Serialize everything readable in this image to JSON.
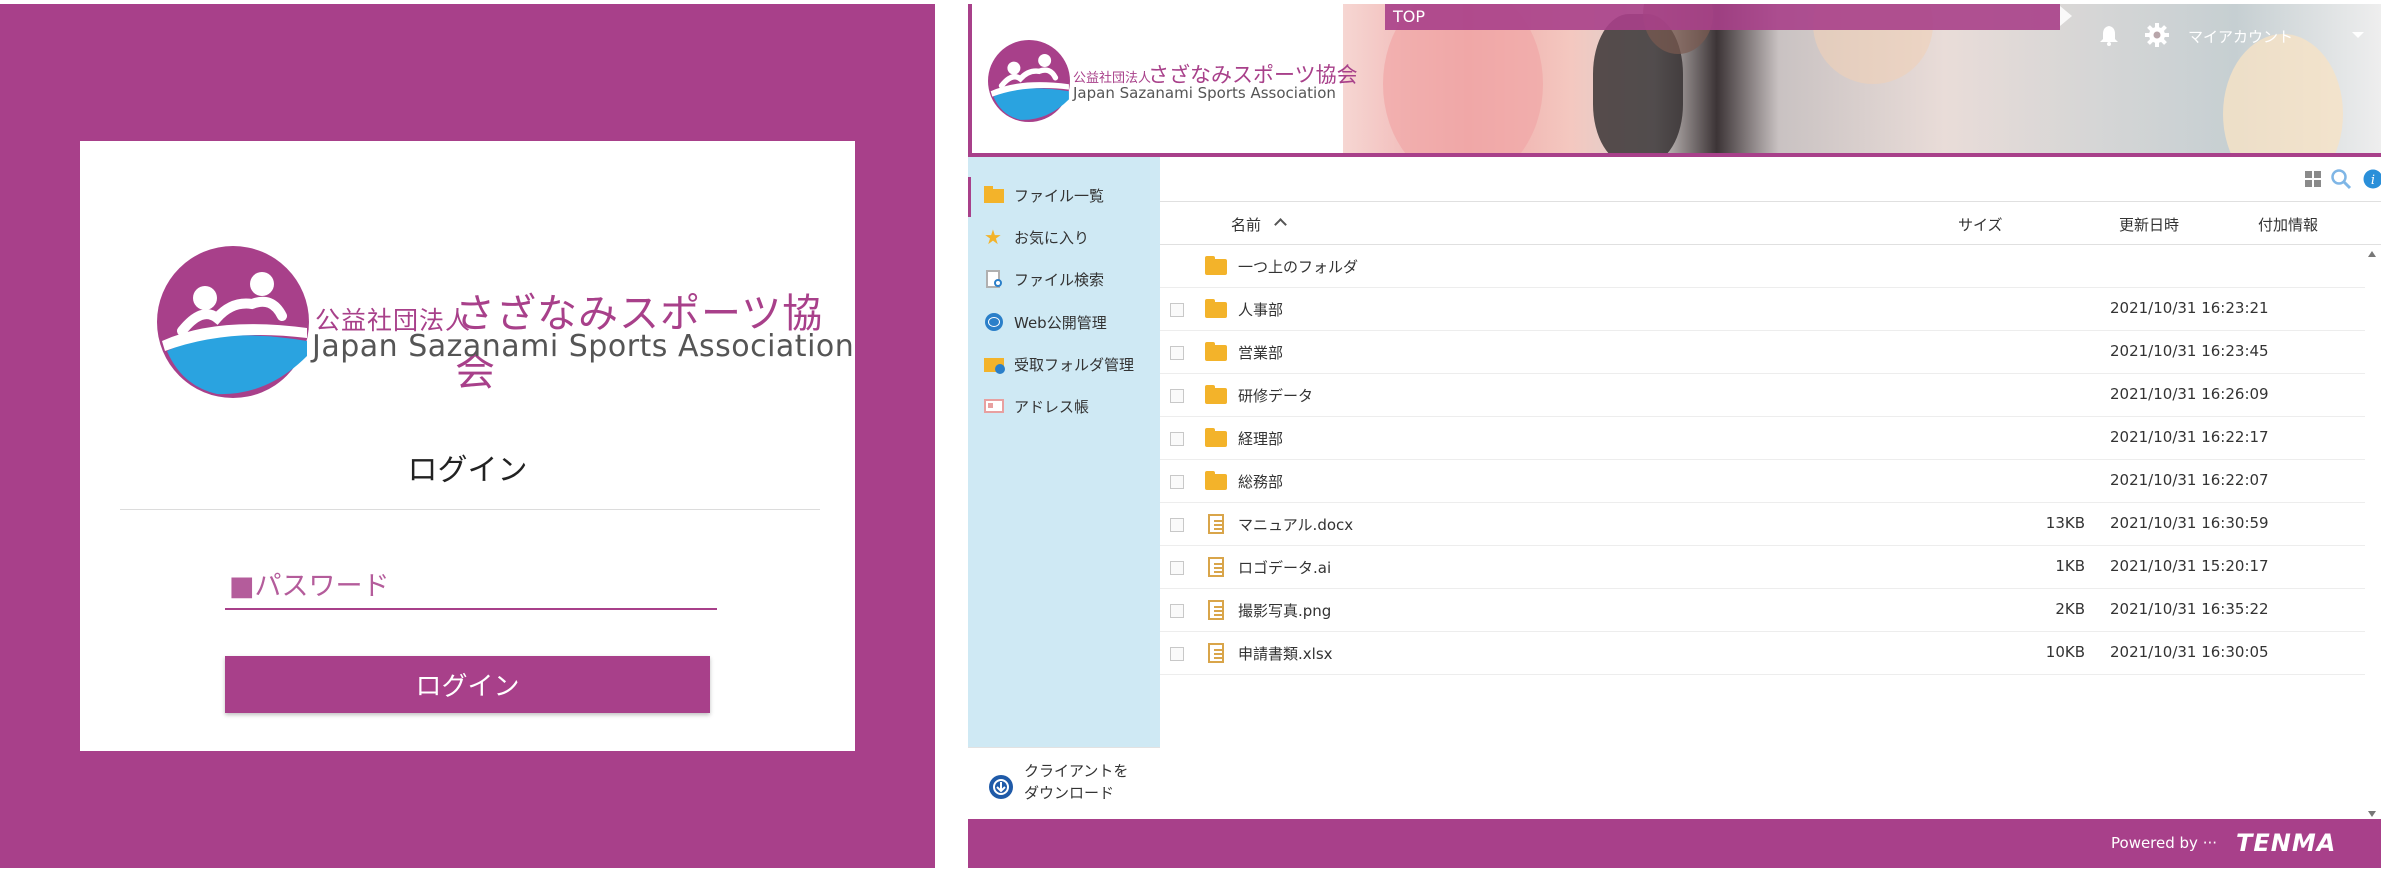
{
  "login": {
    "logo": {
      "jp_small": "公益社団法人",
      "jp_big": "さざなみスポーツ協会",
      "en": "Japan Sazanami Sports Association"
    },
    "title": "ログイン",
    "password_placeholder": "■パスワード",
    "button_label": "ログイン"
  },
  "app": {
    "header": {
      "logo": {
        "jp_small": "公益社団法人",
        "jp_big": "さざなみスポーツ協会",
        "en": "Japan Sazanami Sports Association"
      },
      "top_label": "TOP",
      "account_label": "マイアカウント"
    },
    "sidebar": {
      "items": [
        {
          "label": "ファイル一覧",
          "icon": "folder-icon"
        },
        {
          "label": "お気に入り",
          "icon": "star-icon"
        },
        {
          "label": "ファイル検索",
          "icon": "file-search-icon"
        },
        {
          "label": "Web公開管理",
          "icon": "globe-icon"
        },
        {
          "label": "受取フォルダ管理",
          "icon": "receive-folder-icon"
        },
        {
          "label": "アドレス帳",
          "icon": "address-book-icon"
        }
      ],
      "download_label_line1": "クライアントを",
      "download_label_line2": "ダウンロード"
    },
    "columns": {
      "name": "名前",
      "size": "サイズ",
      "updated": "更新日時",
      "info": "付加情報"
    },
    "rows": [
      {
        "type": "folder",
        "name": "一つ上のフォルダ",
        "size": "",
        "date": "",
        "checkbox": false
      },
      {
        "type": "folder",
        "name": "人事部",
        "size": "",
        "date": "2021/10/31 16:23:21",
        "checkbox": true
      },
      {
        "type": "folder",
        "name": "営業部",
        "size": "",
        "date": "2021/10/31 16:23:45",
        "checkbox": true
      },
      {
        "type": "folder",
        "name": "研修データ",
        "size": "",
        "date": "2021/10/31 16:26:09",
        "checkbox": true
      },
      {
        "type": "folder",
        "name": "経理部",
        "size": "",
        "date": "2021/10/31 16:22:17",
        "checkbox": true
      },
      {
        "type": "folder",
        "name": "総務部",
        "size": "",
        "date": "2021/10/31 16:22:07",
        "checkbox": true
      },
      {
        "type": "file",
        "name": "マニュアル.docx",
        "size": "13KB",
        "date": "2021/10/31 16:30:59",
        "checkbox": true
      },
      {
        "type": "file",
        "name": "ロゴデータ.ai",
        "size": "1KB",
        "date": "2021/10/31 15:20:17",
        "checkbox": true
      },
      {
        "type": "file",
        "name": "撮影写真.png",
        "size": "2KB",
        "date": "2021/10/31 16:35:22",
        "checkbox": true
      },
      {
        "type": "file",
        "name": "申請書類.xlsx",
        "size": "10KB",
        "date": "2021/10/31 16:30:05",
        "checkbox": true
      }
    ],
    "footer": {
      "powered_by": "Powered by ···",
      "brand": "TENMA"
    }
  },
  "colors": {
    "brand_magenta": "#a8408a",
    "sidebar_bg": "#cfe9f4",
    "folder_yellow": "#f3b32a",
    "logo_blue": "#2aa3e0"
  }
}
